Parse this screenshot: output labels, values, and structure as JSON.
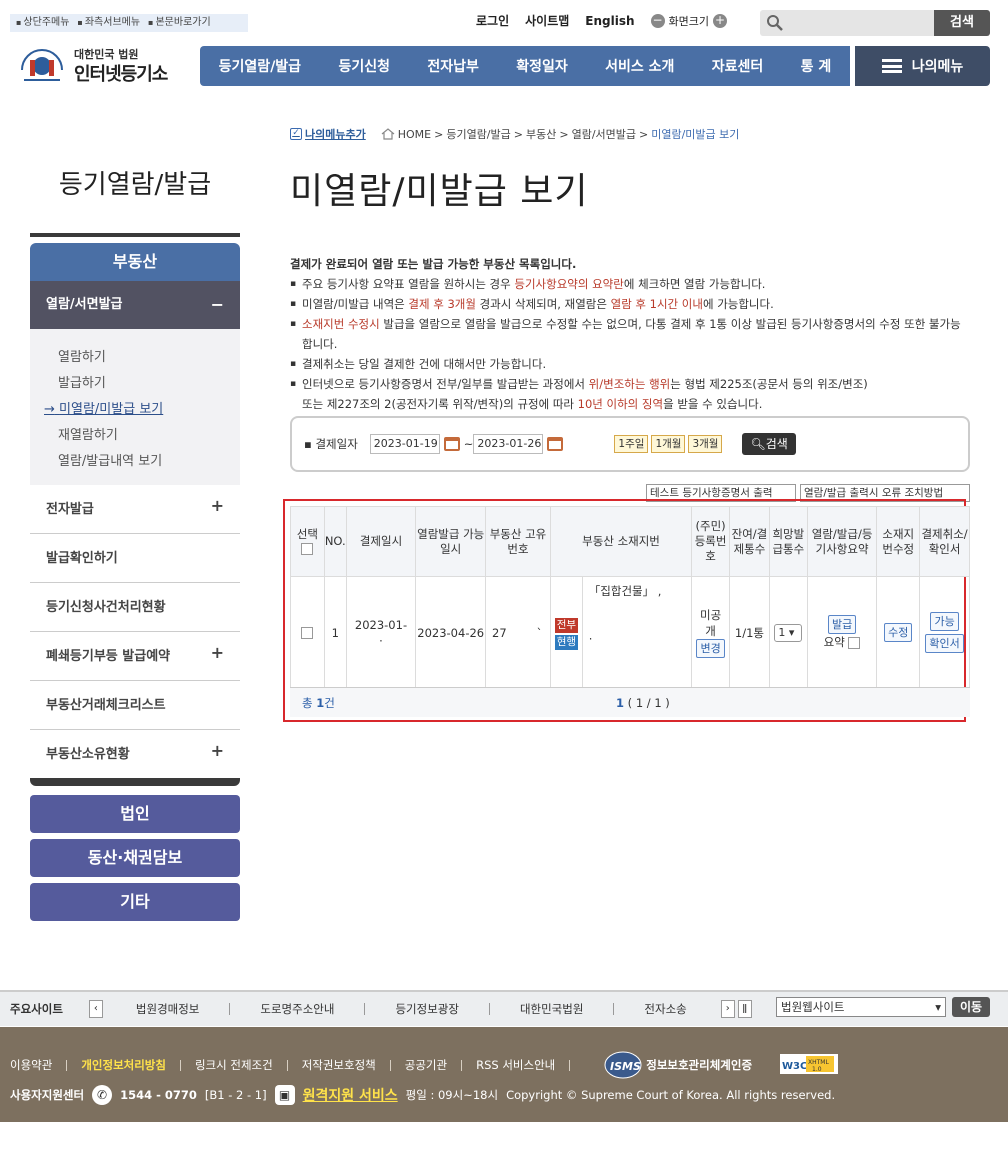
{
  "skip": [
    "상단주메뉴",
    "좌측서브메뉴",
    "본문바로가기"
  ],
  "util": {
    "login": "로그인",
    "sitemap": "사이트맵",
    "english": "English",
    "zoom": "화면크기",
    "minus": "−",
    "plus": "+"
  },
  "search": {
    "button": "검색"
  },
  "logo": {
    "sub": "대한민국 법원",
    "main": "인터넷등기소"
  },
  "gnb": [
    "등기열람/발급",
    "등기신청",
    "전자납부",
    "확정일자",
    "서비스 소개",
    "자료센터",
    "통 계"
  ],
  "mymenu": "나의메뉴",
  "breadcrumb": {
    "add": "나의메뉴추가",
    "home": "HOME",
    "p1": "등기열람/발급",
    "p2": "부동산",
    "p3": "열람/서면발급",
    "current": "미열람/미발급 보기",
    "sep": ">"
  },
  "page_title": "미열람/미발급 보기",
  "side": {
    "title": "등기열람/발급",
    "head": "부동산",
    "sub": "열람/서면발급",
    "sub_icon": "−",
    "list": [
      "열람하기",
      "발급하기",
      "미열람/미발급 보기",
      "재열람하기",
      "열람/발급내역 보기"
    ],
    "active_prefix": "→",
    "items": [
      "전자발급",
      "발급확인하기",
      "등기신청사건처리현황",
      "폐쇄등기부등 발급예약",
      "부동산거래체크리스트",
      "부동산소유현황"
    ],
    "plus": "+",
    "buttons": [
      "법인",
      "동산·채권담보",
      "기타"
    ]
  },
  "intro": {
    "heading": "결제가 완료되어 열람 또는 발급 가능한 부동산 목록입니다.",
    "l1a": "주요 등기사항 요약표 열람을 원하시는 경우 ",
    "l1b": "등기사항요약의 요약란",
    "l1c": "에 체크하면 열람 가능합니다.",
    "l2a": "미열람/미발급 내역은 ",
    "l2b": "결제 후 3개월",
    "l2c": " 경과시 삭제되며, 재열람은 ",
    "l2d": "열람 후 1시간 이내",
    "l2e": "에 가능합니다.",
    "l3a": "소재지번 수정시",
    "l3b": " 발급을 열람으로 열람을 발급으로 수정할 수는 없으며, 다통 결제 후 1통 이상 발급된 등기사항증명서의 수정 또한 불가능",
    "l3c": "합니다.",
    "l4": "결제취소는 당일 결제한 건에 대해서만 가능합니다.",
    "l5a": "인터넷으로 등기사항증명서 전부/일부를 발급받는 과정에서 ",
    "l5b": "위/변조하는 행위",
    "l5c": "는 형법 제225조(공문서 등의 위조/변조)",
    "l6a": "또는 제227조의 2(공전자기록 위작/변작)의 규정에 따라 ",
    "l6b": "10년 이하의 징역",
    "l6c": "을 받을 수 있습니다."
  },
  "filter": {
    "label": "결제일자",
    "from": "2023-01-19",
    "tilde": "~",
    "to": "2023-01-26",
    "periods": [
      "1주일",
      "1개월",
      "3개월"
    ],
    "search": "검색"
  },
  "extra_buttons": [
    "테스트 등기사항증명서 출력",
    "열람/발급 출력시 오류 조치방법"
  ],
  "table": {
    "headers": [
      "선택",
      "NO.",
      "결제일시",
      "열람발급 가능일시",
      "부동산 고유번호",
      "부동산 소재지번",
      "(주민)등록번호",
      "잔여/결제통수",
      "희망발급통수",
      "열람/발급/등기사항요약",
      "소재지번수정",
      "결제취소/확인서"
    ],
    "row": {
      "no": "1",
      "paid": "2023-01-",
      "paid2": "·",
      "available": "2023-04-26",
      "unique_no": "27",
      "mark": "`",
      "tag1": "전부",
      "tag2": "현행",
      "address": "「집합건물」 ,",
      "address2": "·",
      "regno": "미공개",
      "regno_btn": "변경",
      "remaining": "1/1통",
      "copies": "1",
      "issue_btn": "발급",
      "summary": "요약",
      "edit_btn": "수정",
      "cancel_btn": "가능",
      "cert_btn": "확인서"
    },
    "total_label": "총",
    "total_count": "1",
    "total_unit": "건",
    "page": "1",
    "page_info": "( 1 / 1 )"
  },
  "footer_bar": {
    "label": "주요사이트",
    "links": [
      "법원경매정보",
      "도로명주소안내",
      "등기정보광장",
      "대한민국법원",
      "전자소송"
    ],
    "select": "법원웹사이트",
    "move": "이동"
  },
  "footer": {
    "links": [
      "이용약관",
      "개인정보처리방침",
      "링크시 전제조건",
      "저작권보호정책",
      "공공기관",
      "RSS 서비스안내"
    ],
    "isms": "정보보호관리체계인증",
    "support_label": "사용자지원센터",
    "phone": "1544 - 0770",
    "phone_ext": "[B1 - 2 - 1]",
    "remote": "원격지원 서비스",
    "hours": "평일 : 09시~18시",
    "copyright": "Copyright © Supreme Court of Korea. All rights reserved."
  },
  "colors": {
    "nav": "#4a6fa5",
    "mymenu": "#3e4d66",
    "footer": "#7d705f",
    "highlight": "#d8282c",
    "accent_red": "#b83a2a"
  }
}
